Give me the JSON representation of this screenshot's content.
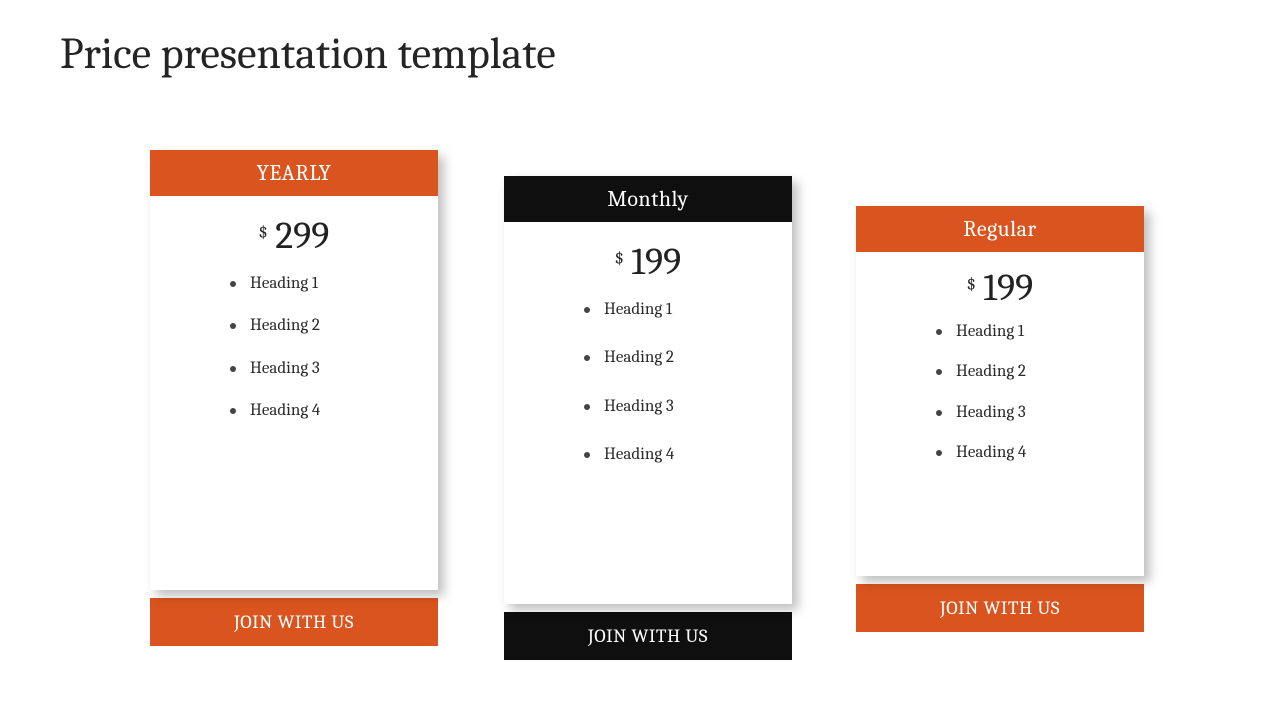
{
  "title": "Price presentation template",
  "accent_orange": "#d9541e",
  "accent_black": "#0f0f0f",
  "currency_symbol": "$",
  "cards": [
    {
      "tier_label": "YEARLY",
      "tier_color": "orange",
      "price": "299",
      "features": [
        "Heading 1",
        "Heading 2",
        "Heading 3",
        "Heading 4"
      ],
      "cta_label": "JOIN WITH US",
      "cta_color": "orange"
    },
    {
      "tier_label": "Monthly",
      "tier_color": "black",
      "price": "199",
      "features": [
        "Heading 1",
        "Heading 2",
        "Heading 3",
        "Heading 4"
      ],
      "cta_label": "JOIN WITH US",
      "cta_color": "black"
    },
    {
      "tier_label": "Regular",
      "tier_color": "orange",
      "price": "199",
      "features": [
        "Heading 1",
        "Heading 2",
        "Heading 3",
        "Heading 4"
      ],
      "cta_label": "JOIN WITH US",
      "cta_color": "orange"
    }
  ]
}
